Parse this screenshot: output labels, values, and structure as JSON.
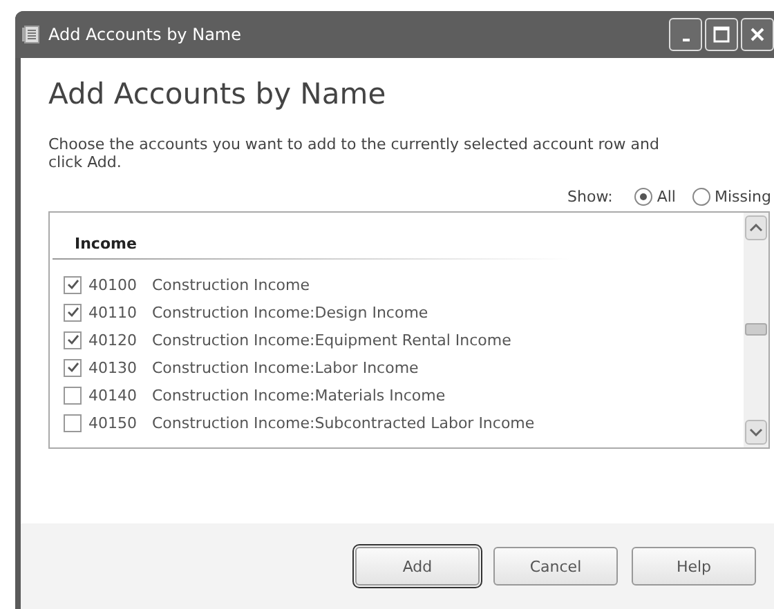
{
  "window": {
    "title": "Add Accounts by Name"
  },
  "heading": "Add Accounts by Name",
  "description": "Choose the accounts you want to add to the currently selected account row and click Add.",
  "show": {
    "label": "Show:",
    "options": [
      {
        "label": "All",
        "selected": true
      },
      {
        "label": "Missing",
        "selected": false
      }
    ]
  },
  "group": "Income",
  "accounts": [
    {
      "number": "40100",
      "name": "Construction Income",
      "checked": true
    },
    {
      "number": "40110",
      "name": "Construction Income:Design Income",
      "checked": true
    },
    {
      "number": "40120",
      "name": "Construction Income:Equipment Rental Income",
      "checked": true
    },
    {
      "number": "40130",
      "name": "Construction Income:Labor Income",
      "checked": true
    },
    {
      "number": "40140",
      "name": "Construction Income:Materials Income",
      "checked": false
    },
    {
      "number": "40150",
      "name": "Construction Income:Subcontracted Labor Income",
      "checked": false
    }
  ],
  "buttons": [
    {
      "label": "Add",
      "default": true
    },
    {
      "label": "Cancel",
      "default": false
    },
    {
      "label": "Help",
      "default": false
    }
  ]
}
